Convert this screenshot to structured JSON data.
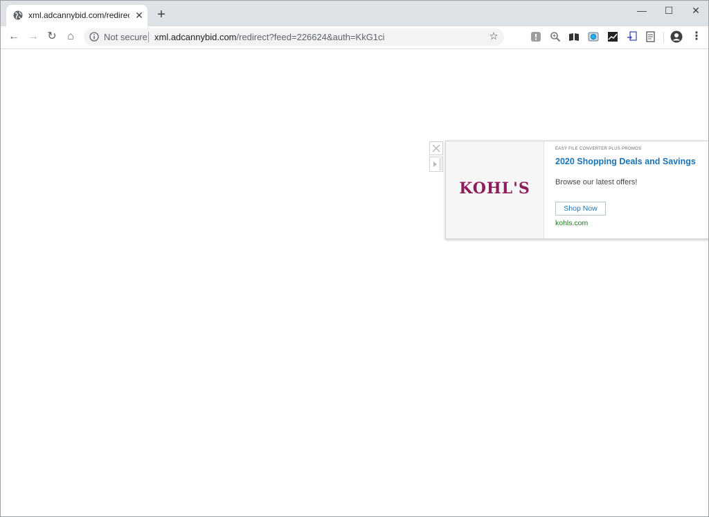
{
  "tab": {
    "title": "xml.adcannybid.com/redirect?feed=226624&auth=KkG1ci",
    "close": "✕"
  },
  "new_tab": "+",
  "window": {
    "minimize": "—",
    "maximize": "☐",
    "close": "✕"
  },
  "nav": {
    "back": "←",
    "forward": "→",
    "reload": "↻",
    "home": "⌂"
  },
  "omnibox": {
    "security": "Not secure",
    "url_domain": "xml.adcannybid.com",
    "url_path": "/redirect?feed=226624&auth=KkG1ci"
  },
  "bookmark_star": "☆",
  "extensions": [
    "extension-gray-icon",
    "magnifier-icon",
    "books-icon",
    "camera-icon",
    "chart-icon",
    "file-arrow-icon",
    "document-icon"
  ],
  "menu": "⋮",
  "ad": {
    "brand": "KOHL'S",
    "sponsor": "EASY FILE CONVERTER PLUS PROMOS",
    "headline": "2020 Shopping Deals and Savings",
    "description": "Browse our latest offers!",
    "cta": "Shop Now",
    "domain": "kohls.com"
  }
}
